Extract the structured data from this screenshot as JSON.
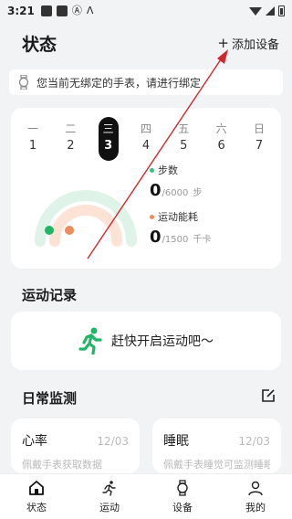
{
  "status_bar": {
    "time": "3:21",
    "icons": [
      "notification-square-icon",
      "notification-square-icon",
      "a-icon",
      "triangle-a-icon",
      "wifi-icon",
      "signal-icon",
      "battery-icon"
    ]
  },
  "header": {
    "title": "状态",
    "add_device": "添加设备",
    "add_icon": "plus-icon"
  },
  "notice": {
    "text": "您当前无绑定的手表，请进行绑定",
    "icon": "watch-icon"
  },
  "week": {
    "days": [
      {
        "name": "一",
        "num": "1"
      },
      {
        "name": "二",
        "num": "2"
      },
      {
        "name": "三",
        "num": "3"
      },
      {
        "name": "四",
        "num": "4"
      },
      {
        "name": "五",
        "num": "5"
      },
      {
        "name": "六",
        "num": "6"
      },
      {
        "name": "日",
        "num": "7"
      }
    ],
    "active_index": 2
  },
  "stats": {
    "steps": {
      "label": "步数",
      "value": "0",
      "target": "/6000",
      "unit": "步",
      "color": "#3fbf7f",
      "progress": 0
    },
    "calories": {
      "label": "运动能耗",
      "value": "0",
      "target": "/1500",
      "unit": "千卡",
      "color": "#f08c5a",
      "progress": 0
    }
  },
  "records": {
    "title": "运动记录",
    "empty_text": "赶快开启运动吧～",
    "icon": "running-person-icon",
    "icon_color": "#1fb766"
  },
  "monitor": {
    "title": "日常监测",
    "edit_icon": "edit-icon",
    "cards": [
      {
        "title": "心率",
        "date": "12/03",
        "sub": "佩戴手表获取数据"
      },
      {
        "title": "睡眠",
        "date": "12/03",
        "sub": "佩戴手表睡觉可监测睡眠"
      }
    ]
  },
  "tabs": [
    {
      "label": "状态",
      "icon": "home-icon"
    },
    {
      "label": "运动",
      "icon": "run-icon"
    },
    {
      "label": "设备",
      "icon": "watch-icon"
    },
    {
      "label": "我的",
      "icon": "person-icon"
    }
  ],
  "colors": {
    "annotation_arrow": "#d0282e",
    "accent_green": "#1fb766",
    "gauge_green": "#dff3e8",
    "gauge_orange": "#fde3d6"
  }
}
